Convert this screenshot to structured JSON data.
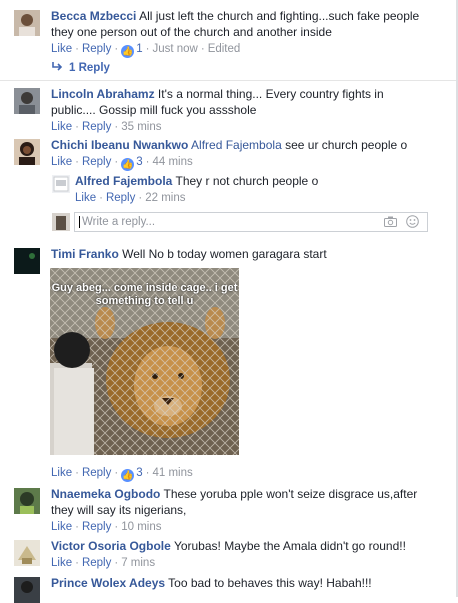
{
  "comments": [
    {
      "author": "Becca Mzbecci",
      "text": "All just left the church and fighting...such fake people they one person out of the church and another inside",
      "like": "Like",
      "reply": "Reply",
      "likes": "1",
      "time": "Just now",
      "edited": "Edited",
      "reply_count_label": "1 Reply"
    },
    {
      "author": "Lincoln Abrahamz",
      "text": "It's a normal thing... Every country fights in public.... Gossip mill fuck you assshole",
      "like": "Like",
      "reply": "Reply",
      "time": "35 mins"
    },
    {
      "author": "Chichi Ibeanu Nwankwo",
      "tag": "Alfred Fajembola",
      "text": "see ur church people o",
      "like": "Like",
      "reply": "Reply",
      "likes": "3",
      "time": "44 mins"
    },
    {
      "author": "Alfred Fajembola",
      "text": "They r not church people o",
      "like": "Like",
      "reply": "Reply",
      "time": "22 mins"
    },
    {
      "author": "Timi Franko",
      "text": "Well No b today women garagara start",
      "photo_caption": "Guy abeg... come inside cage.. i get something to tell u",
      "like": "Like",
      "reply": "Reply",
      "likes": "3",
      "time": "41 mins"
    },
    {
      "author": "Nnaemeka Ogbodo",
      "text": "These yoruba pple won't seize disgrace us,after they will say its nigerians,",
      "like": "Like",
      "reply": "Reply",
      "time": "10 mins"
    },
    {
      "author": "Victor Osoria Ogbole",
      "text": "Yorubas! Maybe the Amala didn't go round!!",
      "like": "Like",
      "reply": "Reply",
      "time": "7 mins"
    },
    {
      "author": "Prince Wolex Adeys",
      "text": "Too bad to behaves this way! Habah!!!"
    }
  ],
  "reply_box": {
    "placeholder": "Write a reply..."
  },
  "icons": {
    "like": "thumbs-up-icon",
    "reply_arrow": "reply-arrow-icon",
    "camera": "camera-icon",
    "emoji": "emoji-icon"
  },
  "colors": {
    "link": "#365899",
    "action": "#4267b2",
    "meta": "#90949c",
    "like_badge": "#5890ff"
  }
}
